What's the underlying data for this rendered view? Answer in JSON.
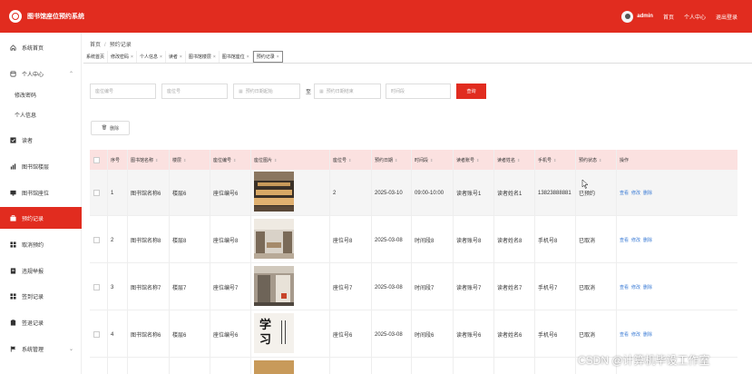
{
  "header": {
    "app_title": "图书馆座位预约系统",
    "username": "admin",
    "links": [
      "首页",
      "个人中心",
      "退出登录"
    ]
  },
  "sidebar": {
    "items": [
      {
        "label": "系统首页",
        "icon": "home-icon"
      },
      {
        "label": "个人中心",
        "icon": "user-icon"
      },
      {
        "label": "修改密码",
        "icon": ""
      },
      {
        "label": "个人信息",
        "icon": ""
      },
      {
        "label": "读者",
        "icon": "check-square-icon"
      },
      {
        "label": "图书馆楼层",
        "icon": "bar-chart-icon"
      },
      {
        "label": "图书馆座位",
        "icon": "monitor-icon"
      },
      {
        "label": "预约记录",
        "icon": "briefcase-icon"
      },
      {
        "label": "取消预约",
        "icon": "grid-icon"
      },
      {
        "label": "违规举报",
        "icon": "document-icon"
      },
      {
        "label": "签到记录",
        "icon": "grid-icon"
      },
      {
        "label": "签退记录",
        "icon": "clipboard-icon"
      },
      {
        "label": "系统管理",
        "icon": "flag-icon"
      }
    ],
    "active_label": "预约记录"
  },
  "breadcrumb": {
    "home": "首页",
    "sep": "/",
    "current": "预约记录"
  },
  "tabs": [
    "系统首页",
    "修改密码",
    "个人信息",
    "读者",
    "图书馆楼层",
    "图书馆座位",
    "预约记录"
  ],
  "search": {
    "seat_no_placeholder": "座位编号",
    "seat_placeholder": "座位号",
    "date_start_placeholder": "预约日期起始",
    "to_label": "至",
    "date_end_placeholder": "预约日期结束",
    "time_slot_placeholder": "时间段",
    "search_label": "查询"
  },
  "actions": {
    "delete_label": "删除"
  },
  "table": {
    "columns": [
      "序号",
      "图书馆名称",
      "楼层",
      "座位编号",
      "座位图片",
      "座位号",
      "预约日期",
      "时间段",
      "读者账号",
      "读者姓名",
      "手机号",
      "预约状态",
      "操作"
    ],
    "rows": [
      {
        "no": "1",
        "name": "图书馆名称6",
        "floor": "楼层6",
        "seat_code": "座位编号6",
        "seat": "2",
        "date": "2025-03-10",
        "slot": "09:00-10:00",
        "account": "读者账号1",
        "reader": "读者姓名1",
        "phone": "13823888881",
        "status": "已预约",
        "image": "study-hall"
      },
      {
        "no": "2",
        "name": "图书馆名称8",
        "floor": "楼层8",
        "seat_code": "座位编号8",
        "seat": "座位号8",
        "date": "2025-03-08",
        "slot": "时间段8",
        "account": "读者账号8",
        "reader": "读者姓名8",
        "phone": "手机号8",
        "status": "已取消",
        "image": "library-interior"
      },
      {
        "no": "3",
        "name": "图书馆名称7",
        "floor": "楼层7",
        "seat_code": "座位编号7",
        "seat": "座位号7",
        "date": "2025-03-08",
        "slot": "时间段7",
        "account": "读者账号7",
        "reader": "读者姓名7",
        "phone": "手机号7",
        "status": "已取消",
        "image": "hallway"
      },
      {
        "no": "4",
        "name": "图书馆名称6",
        "floor": "楼层6",
        "seat_code": "座位编号6",
        "seat": "座位号6",
        "date": "2025-03-08",
        "slot": "时间段6",
        "account": "读者账号6",
        "reader": "读者姓名6",
        "phone": "手机号6",
        "status": "已取消",
        "image": "study-poster"
      }
    ],
    "ops": [
      "查看",
      "修改",
      "删除"
    ],
    "poster_text": "学习"
  },
  "watermark": "CSDN @计算机毕设工作室",
  "colors": {
    "accent": "#e12c1f",
    "header_bg": "#fbe1e0",
    "link": "#3a7bd5"
  }
}
